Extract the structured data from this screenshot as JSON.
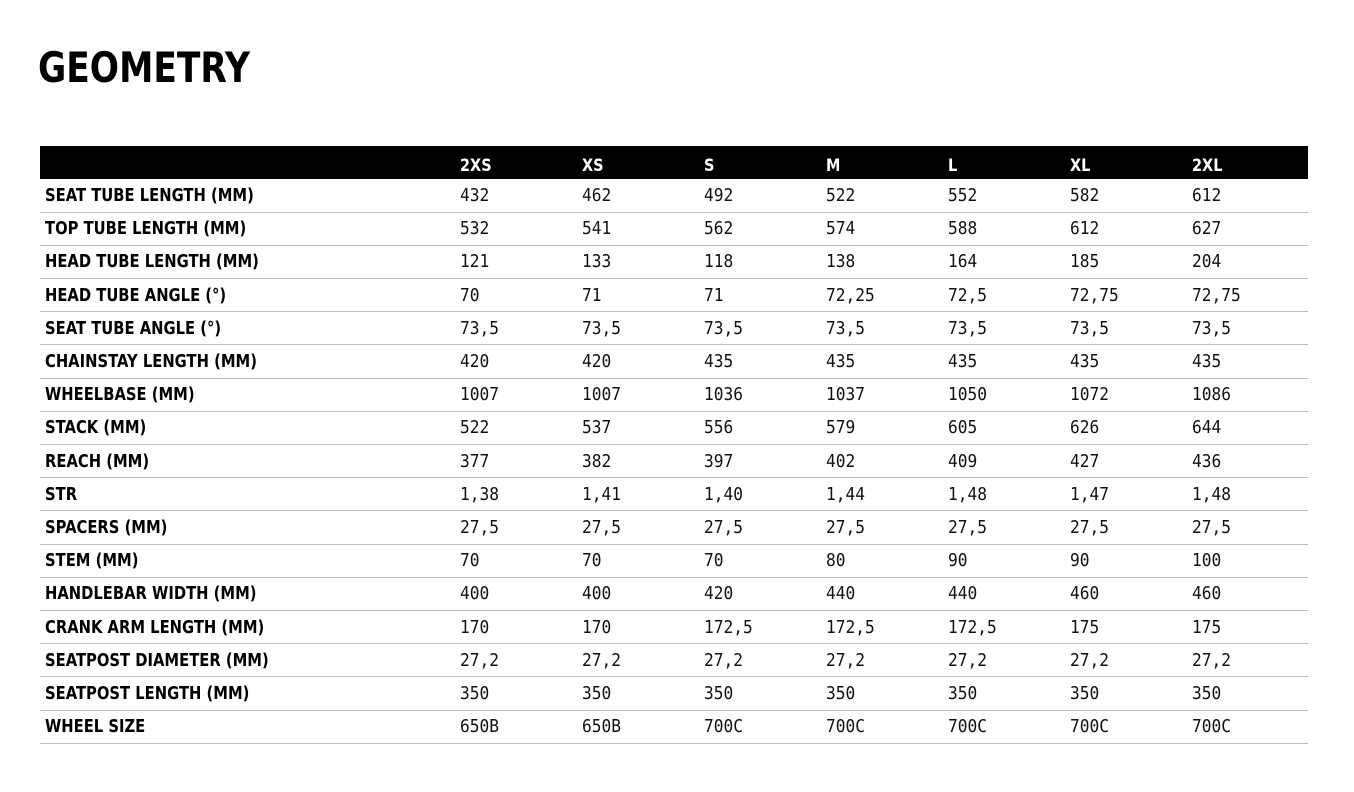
{
  "page": {
    "title": "GEOMETRY"
  },
  "table": {
    "header": [
      "",
      "2XS",
      "XS",
      "S",
      "M",
      "L",
      "XL",
      "2XL"
    ],
    "rows": [
      {
        "label": "SEAT TUBE LENGTH (MM)",
        "values": [
          "432",
          "462",
          "492",
          "522",
          "552",
          "582",
          "612"
        ]
      },
      {
        "label": "TOP TUBE LENGTH (MM)",
        "values": [
          "532",
          "541",
          "562",
          "574",
          "588",
          "612",
          "627"
        ]
      },
      {
        "label": "HEAD TUBE LENGTH (MM)",
        "values": [
          "121",
          "133",
          "118",
          "138",
          "164",
          "185",
          "204"
        ]
      },
      {
        "label": "HEAD TUBE ANGLE (°)",
        "values": [
          "70",
          "71",
          "71",
          "72,25",
          "72,5",
          "72,75",
          "72,75"
        ]
      },
      {
        "label": "SEAT TUBE ANGLE (°)",
        "values": [
          "73,5",
          "73,5",
          "73,5",
          "73,5",
          "73,5",
          "73,5",
          "73,5"
        ]
      },
      {
        "label": "CHAINSTAY LENGTH (MM)",
        "values": [
          "420",
          "420",
          "435",
          "435",
          "435",
          "435",
          "435"
        ]
      },
      {
        "label": "WHEELBASE (MM)",
        "values": [
          "1007",
          "1007",
          "1036",
          "1037",
          "1050",
          "1072",
          "1086"
        ]
      },
      {
        "label": "STACK (MM)",
        "values": [
          "522",
          "537",
          "556",
          "579",
          "605",
          "626",
          "644"
        ]
      },
      {
        "label": "REACH (MM)",
        "values": [
          "377",
          "382",
          "397",
          "402",
          "409",
          "427",
          "436"
        ]
      },
      {
        "label": "STR",
        "values": [
          "1,38",
          "1,41",
          "1,40",
          "1,44",
          "1,48",
          "1,47",
          "1,48"
        ]
      },
      {
        "label": "SPACERS (MM)",
        "values": [
          "27,5",
          "27,5",
          "27,5",
          "27,5",
          "27,5",
          "27,5",
          "27,5"
        ]
      },
      {
        "label": "STEM (MM)",
        "values": [
          "70",
          "70",
          "70",
          "80",
          "90",
          "90",
          "100"
        ]
      },
      {
        "label": "HANDLEBAR WIDTH (MM)",
        "values": [
          "400",
          "400",
          "420",
          "440",
          "440",
          "460",
          "460"
        ]
      },
      {
        "label": "CRANK ARM LENGTH (MM)",
        "values": [
          "170",
          "170",
          "172,5",
          "172,5",
          "172,5",
          "175",
          "175"
        ]
      },
      {
        "label": "SEATPOST DIAMETER (MM)",
        "values": [
          "27,2",
          "27,2",
          "27,2",
          "27,2",
          "27,2",
          "27,2",
          "27,2"
        ]
      },
      {
        "label": "SEATPOST LENGTH (MM)",
        "values": [
          "350",
          "350",
          "350",
          "350",
          "350",
          "350",
          "350"
        ]
      },
      {
        "label": "WHEEL SIZE",
        "values": [
          "650B",
          "650B",
          "700C",
          "700C",
          "700C",
          "700C",
          "700C"
        ]
      }
    ]
  },
  "colors": {
    "header_bg": "#000000",
    "header_text": "#ffffff",
    "row_divider": "#bdbdbd",
    "text": "#000000"
  }
}
